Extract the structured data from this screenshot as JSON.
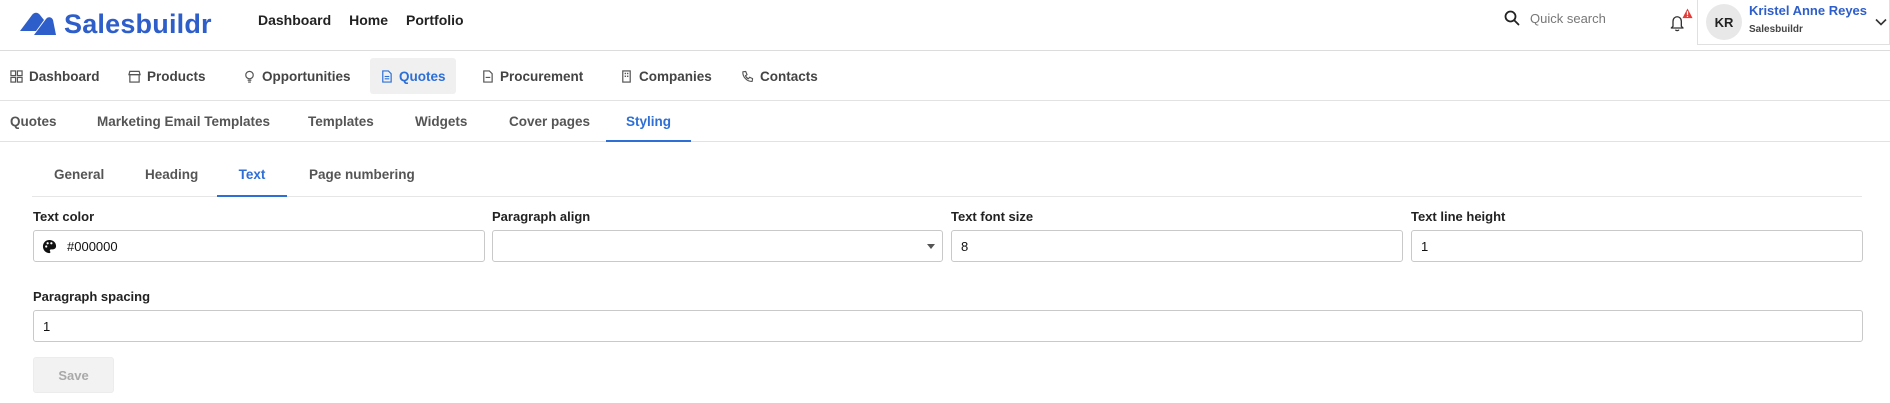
{
  "brand": {
    "name": "Salesbuildr",
    "color": "#2d5ec9"
  },
  "top_nav": [
    "Dashboard",
    "Home",
    "Portfolio"
  ],
  "search": {
    "placeholder": "Quick search",
    "icon": "search-icon"
  },
  "notifications": {
    "icon": "bell-icon",
    "badge": "!",
    "badge_color": "#e53935"
  },
  "user": {
    "initials": "KR",
    "name": "Kristel Anne Reyes",
    "org": "Salesbuildr"
  },
  "modules": [
    {
      "label": "Dashboard",
      "icon": "grid-icon"
    },
    {
      "label": "Products",
      "icon": "store-icon"
    },
    {
      "label": "Opportunities",
      "icon": "lightbulb-icon"
    },
    {
      "label": "Quotes",
      "icon": "document-icon",
      "active": true
    },
    {
      "label": "Procurement",
      "icon": "file-icon"
    },
    {
      "label": "Companies",
      "icon": "building-icon"
    },
    {
      "label": "Contacts",
      "icon": "phone-icon"
    }
  ],
  "sub_tabs": [
    "Quotes",
    "Marketing Email Templates",
    "Templates",
    "Widgets",
    "Cover pages",
    "Styling"
  ],
  "sub_tab_active": "Styling",
  "inner_tabs": [
    "General",
    "Heading",
    "Text",
    "Page numbering"
  ],
  "inner_tab_active": "Text",
  "form": {
    "text_color": {
      "label": "Text color",
      "value": "#000000",
      "icon": "palette-icon"
    },
    "paragraph_align": {
      "label": "Paragraph align",
      "value": ""
    },
    "text_font_size": {
      "label": "Text font size",
      "value": "8"
    },
    "text_line_height": {
      "label": "Text line height",
      "value": "1"
    },
    "paragraph_spacing": {
      "label": "Paragraph spacing",
      "value": "1"
    }
  },
  "save_label": "Save",
  "accent_color": "#2d6fd6"
}
